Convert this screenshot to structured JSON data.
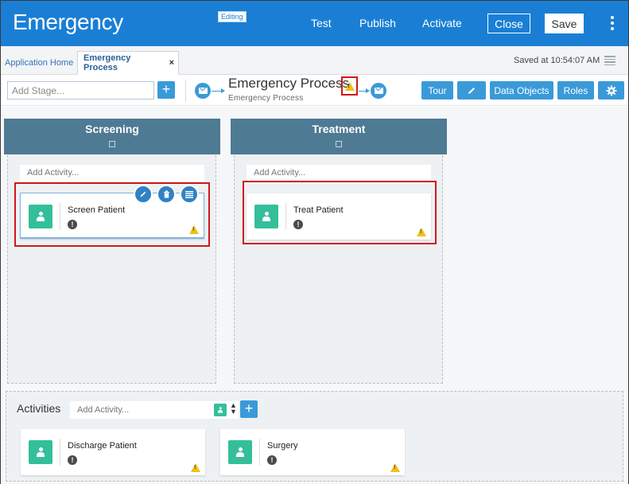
{
  "header": {
    "title": "Emergency",
    "editing_badge": "Editing",
    "nav": [
      "Test",
      "Publish",
      "Activate"
    ],
    "close_label": "Close",
    "save_label": "Save",
    "background_color": "#1a7fd4"
  },
  "tabs": {
    "home_label": "Application Home",
    "active_label": "Emergency Process",
    "close_symbol": "×",
    "saved_at": "Saved at 10:54:07 AM"
  },
  "toolbar": {
    "add_stage_placeholder": "Add Stage...",
    "plus_symbol": "+",
    "process_title": "Emergency Process",
    "process_subtitle": "Emergency Process",
    "buttons": [
      "Tour",
      "Data Objects",
      "Roles"
    ],
    "icons": [
      "pencil-icon",
      "gear-icon",
      "warning-icon",
      "mail-icon"
    ]
  },
  "stages": [
    {
      "name": "Screening",
      "add_activity_placeholder": "Add Activity...",
      "activities": [
        {
          "name": "Screen Patient",
          "info": "!",
          "selected": true
        }
      ]
    },
    {
      "name": "Treatment",
      "add_activity_placeholder": "Add Activity...",
      "activities": [
        {
          "name": "Treat Patient",
          "info": "!",
          "selected": true
        }
      ]
    }
  ],
  "activities_pane": {
    "title": "Activities",
    "add_placeholder": "Add Activity...",
    "plus_symbol": "+",
    "items": [
      {
        "name": "Discharge Patient",
        "info": "!"
      },
      {
        "name": "Surgery",
        "info": "!"
      }
    ]
  },
  "colors": {
    "accent": "#3a9ad9",
    "stage_header": "#4f7a93",
    "activity_icon": "#34bf9a",
    "highlight": "#d01818",
    "warning": "#f2c014"
  }
}
